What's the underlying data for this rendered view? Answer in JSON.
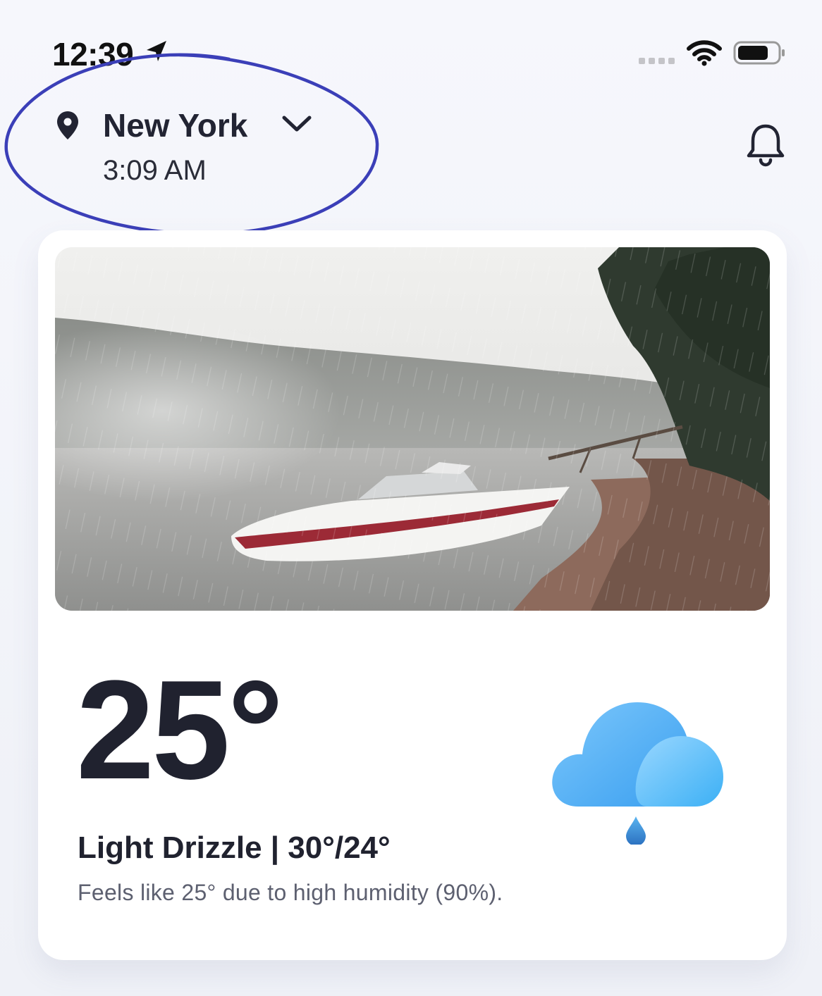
{
  "status_bar": {
    "time": "12:39",
    "icons": [
      "location-arrow-icon",
      "signal-icon",
      "wifi-icon",
      "battery-icon"
    ]
  },
  "header": {
    "city": "New York",
    "local_time": "3:09 AM",
    "icons": [
      "map-pin-icon",
      "chevron-down-icon",
      "bell-icon"
    ]
  },
  "weather_card": {
    "temperature": "25°",
    "summary": "Light Drizzle | 30°/24°",
    "feels_like": "Feels like 25° due to high humidity (90%).",
    "condition_icon": "rain-cloud-icon",
    "photo": "rainy lake with motorboat on shore"
  },
  "colors": {
    "annotation_ring": "#3b3fb8",
    "text_primary": "#20222f",
    "text_secondary": "#5d6070",
    "cloud_light": "#7cc7fb",
    "cloud_dark": "#3a9ff0"
  }
}
